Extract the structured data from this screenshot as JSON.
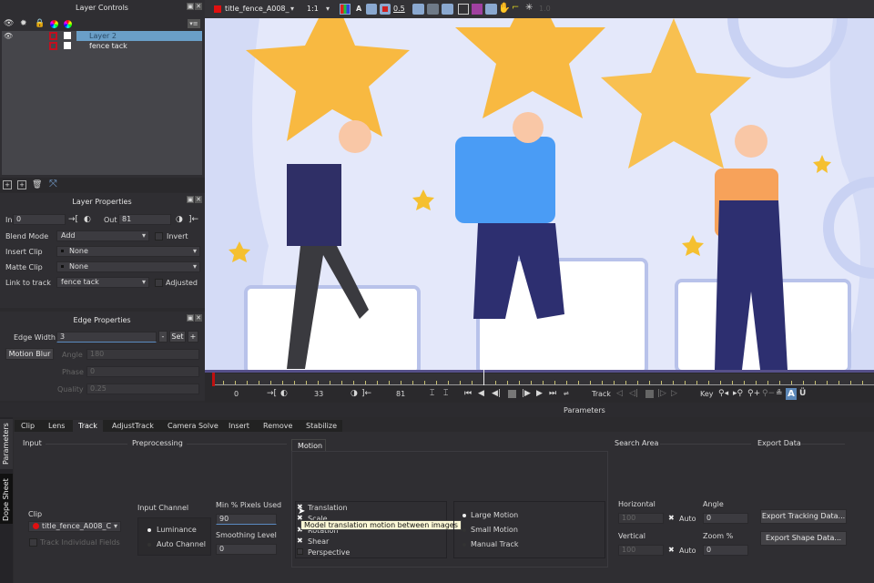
{
  "layer_controls": {
    "title": "Layer Controls",
    "header_icons": [
      "eye-icon",
      "gear-icon",
      "lock-icon",
      "color-wheel-icon",
      "color-wheel-icon"
    ],
    "layers": [
      {
        "name": "Layer 2",
        "selected": true
      },
      {
        "name": "fence tack",
        "selected": false
      }
    ],
    "bottom_icons": [
      "new-layer-icon",
      "duplicate-layer-icon",
      "trash-icon",
      "fit-icon"
    ]
  },
  "layer_properties": {
    "title": "Layer Properties",
    "in_label": "In",
    "in_value": "0",
    "out_label": "Out",
    "out_value": "81",
    "blend_mode_label": "Blend Mode",
    "blend_mode_value": "Add",
    "invert_label": "Invert",
    "insert_clip_label": "Insert Clip",
    "insert_clip_value": "None",
    "matte_clip_label": "Matte Clip",
    "matte_clip_value": "None",
    "link_to_track_label": "Link to track",
    "link_to_track_value": "fence tack",
    "adjusted_label": "Adjusted"
  },
  "edge_properties": {
    "title": "Edge Properties",
    "edge_width_label": "Edge Width",
    "edge_width_value": "3",
    "minus_label": "-",
    "set_label": "Set",
    "plus_label": "+",
    "motion_blur_label": "Motion Blur",
    "angle_label": "Angle",
    "angle_value": "180",
    "phase_label": "Phase",
    "phase_value": "0",
    "quality_label": "Quality",
    "quality_value": "0.25"
  },
  "viewer_toolbar": {
    "clip_name": "title_fence_A008_",
    "zoom": "1:1",
    "channel_label": "A",
    "opacity_value": "0.5",
    "clip_color": "#e01010"
  },
  "timeline": {
    "start_frame": "0",
    "current_frame": "33",
    "end_frame": "81",
    "track_label": "Track",
    "key_label": "Key",
    "progress": 0.41
  },
  "parameters": {
    "title": "Parameters",
    "side_tabs": [
      "Parameters",
      "Dope Sheet"
    ],
    "tabs": [
      "Clip",
      "Lens",
      "Track",
      "AdjustTrack",
      "Camera Solve",
      "Insert",
      "Remove",
      "Stabilize"
    ],
    "active_tab": "Track",
    "input": {
      "section": "Input",
      "clip_label": "Clip",
      "clip_value": "title_fence_A008_C",
      "track_fields_label": "Track Individual Fields"
    },
    "preprocessing": {
      "section": "Preprocessing",
      "input_channel_label": "Input Channel",
      "luminance_label": "Luminance",
      "auto_channel_label": "Auto Channel",
      "min_pixels_label": "Min % Pixels Used",
      "min_pixels_value": "90",
      "smoothing_label": "Smoothing Level",
      "smoothing_value": "0"
    },
    "motion": {
      "tab": "Motion",
      "translation_label": "Translation",
      "scale_label": "Scale",
      "rotation_label": "Rotation",
      "shear_label": "Shear",
      "perspective_label": "Perspective",
      "tooltip": "Model translation motion between images",
      "large_motion_label": "Large Motion",
      "small_motion_label": "Small Motion",
      "manual_track_label": "Manual Track"
    },
    "search_area": {
      "section": "Search Area",
      "horizontal_label": "Horizontal",
      "horizontal_value": "100",
      "vertical_label": "Vertical",
      "vertical_value": "100",
      "auto_label": "Auto",
      "angle_label": "Angle",
      "angle_value": "0",
      "zoom_label": "Zoom %",
      "zoom_value": "0"
    },
    "export_data": {
      "section": "Export Data",
      "export_tracking_label": "Export Tracking Data...",
      "export_shape_label": "Export Shape Data..."
    }
  }
}
